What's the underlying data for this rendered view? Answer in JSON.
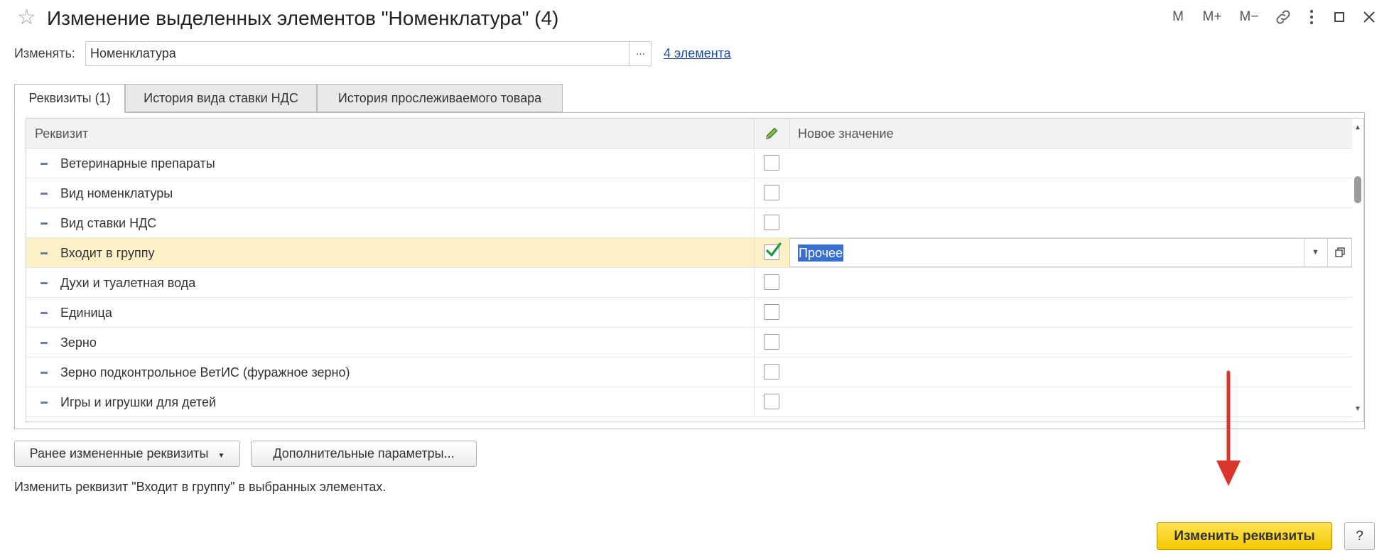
{
  "window": {
    "title": "Изменение выделенных элементов \"Номенклатура\" (4)",
    "buttons": [
      "M",
      "M+",
      "M−"
    ]
  },
  "change": {
    "label": "Изменять:",
    "value": "Номенклатура",
    "dots": "...",
    "count_link": "4 элемента"
  },
  "tabs": [
    {
      "label": "Реквизиты (1)",
      "active": true
    },
    {
      "label": "История вида ставки НДС",
      "active": false
    },
    {
      "label": "История прослеживаемого товара",
      "active": false
    }
  ],
  "table": {
    "columns": {
      "attribute": "Реквизит",
      "new_value": "Новое значение"
    },
    "rows": [
      {
        "name": "Ветеринарные препараты",
        "checked": false
      },
      {
        "name": "Вид номенклатуры",
        "checked": false
      },
      {
        "name": "Вид ставки НДС",
        "checked": false
      },
      {
        "name": "Входит в группу",
        "checked": true,
        "selected": true,
        "new_value": "Прочее"
      },
      {
        "name": "Духи и туалетная вода",
        "checked": false
      },
      {
        "name": "Единица",
        "checked": false
      },
      {
        "name": "Зерно",
        "checked": false
      },
      {
        "name": "Зерно подконтрольное ВетИС (фуражное зерно)",
        "checked": false
      },
      {
        "name": "Игры и игрушки для детей",
        "checked": false
      }
    ]
  },
  "actions": {
    "previous_attributes": "Ранее измененные реквизиты",
    "extra_params": "Дополнительные параметры...",
    "hint": "Изменить реквизит \"Входит в группу\" в выбранных элементах.",
    "primary": "Изменить реквизиты",
    "help": "?"
  },
  "colors": {
    "accent_link": "#1b4e9b",
    "selected_row": "#fbf0c6",
    "primary_button": "#f4c800",
    "arrow": "#d9352b"
  }
}
